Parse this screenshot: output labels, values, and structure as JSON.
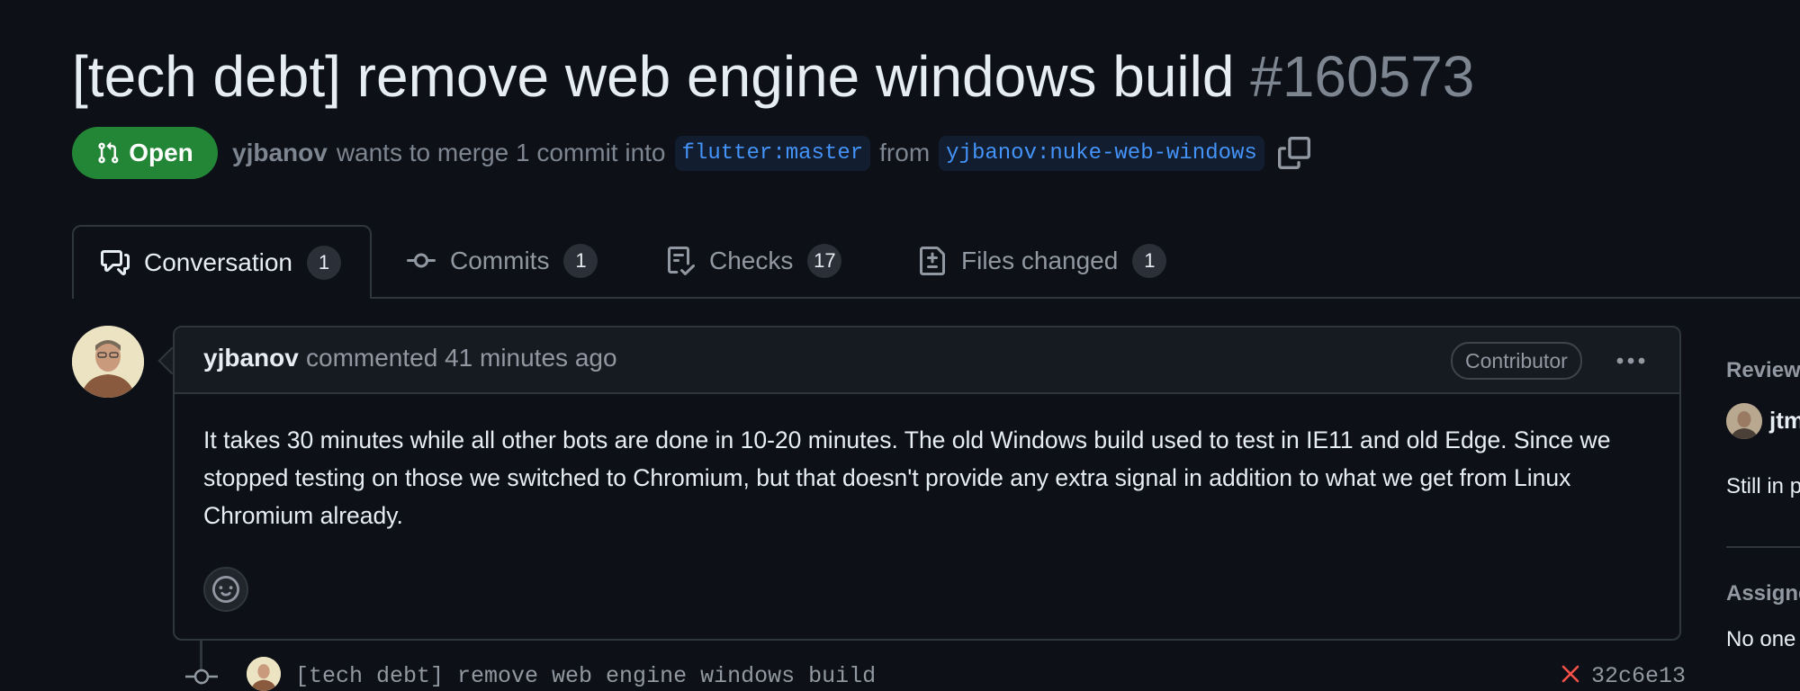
{
  "pr": {
    "title": "[tech debt] remove web engine windows build",
    "number": "#160573",
    "state": "Open",
    "author": "yjbanov",
    "merge_text": "wants to merge 1 commit into",
    "base_branch": "flutter:master",
    "from_text": "from",
    "head_branch": "yjbanov:nuke-web-windows"
  },
  "tabs": [
    {
      "label": "Conversation",
      "count": "1",
      "icon": "comment-discussion-icon",
      "active": true
    },
    {
      "label": "Commits",
      "count": "1",
      "icon": "git-commit-icon"
    },
    {
      "label": "Checks",
      "count": "17",
      "icon": "checklist-icon"
    },
    {
      "label": "Files changed",
      "count": "1",
      "icon": "file-diff-icon"
    }
  ],
  "comment": {
    "author": "yjbanov",
    "time": "commented 41 minutes ago",
    "badge": "Contributor",
    "body": "It takes 30 minutes while all other bots are done in 10-20 minutes. The old Windows build used to test in IE11 and old Edge. Since we stopped testing on those we switched to Chromium, but that doesn't provide any extra signal in addition to what we get from Linux Chromium already."
  },
  "commit": {
    "message": "[tech debt] remove web engine windows build",
    "sha": "32c6e13",
    "status_icon": "x-fail-icon"
  },
  "sidebar": {
    "reviewers_heading": "Review",
    "reviewer_name": "jtm",
    "reviewer_status": "Still in p",
    "assignees_heading": "Assigne",
    "assignees_value": "No one"
  },
  "colors": {
    "background": "#0d1117",
    "open_green": "#238636",
    "branch_blue": "#4493f8",
    "fail_red": "#f85149"
  }
}
